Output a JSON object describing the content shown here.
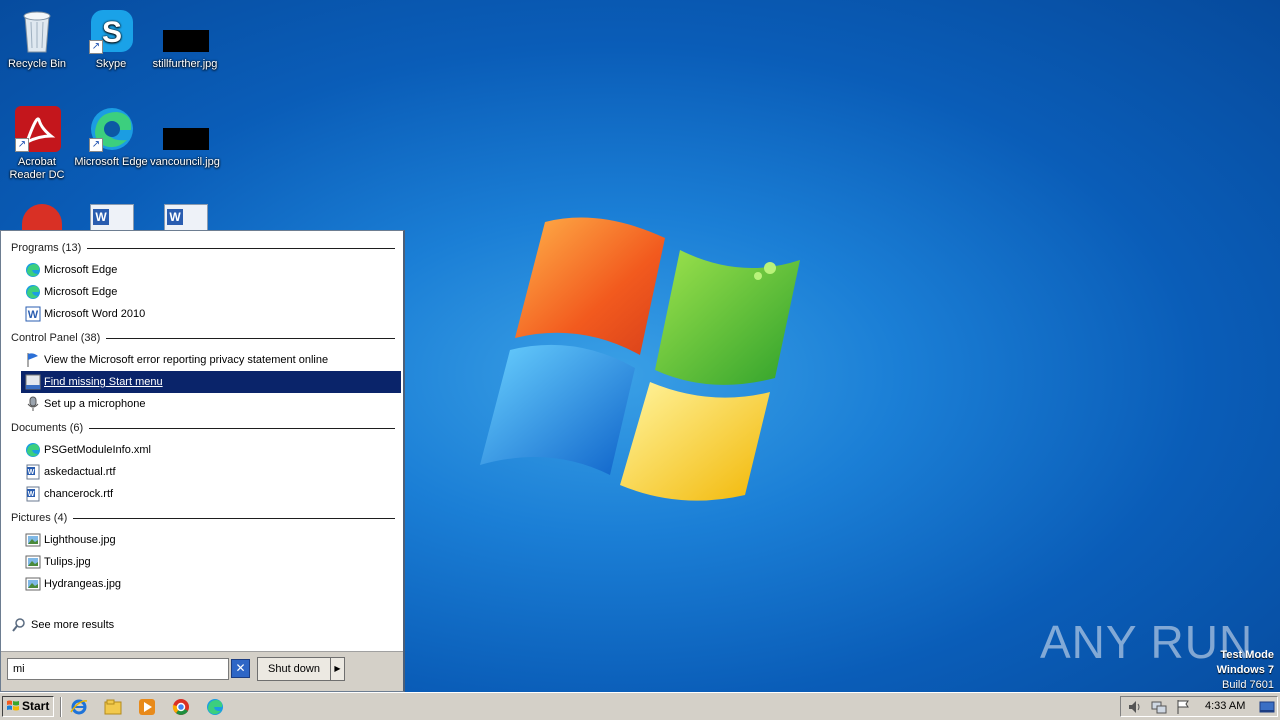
{
  "desktop": {
    "icons": [
      {
        "label": "Recycle Bin",
        "icon": "recycle-bin-icon"
      },
      {
        "label": "Skype",
        "icon": "skype-icon"
      },
      {
        "label": "stillfurther.jpg",
        "icon": "image-file-icon"
      },
      {
        "label": "Acrobat Reader DC",
        "icon": "acrobat-icon"
      },
      {
        "label": "Microsoft Edge",
        "icon": "edge-icon"
      },
      {
        "label": "vancouncil.jpg",
        "icon": "image-file-icon"
      }
    ]
  },
  "start_menu": {
    "sections": [
      {
        "title": "Programs (13)",
        "items": [
          {
            "label": "Microsoft Edge",
            "icon": "edge-icon"
          },
          {
            "label": "Microsoft Edge",
            "icon": "edge-icon"
          },
          {
            "label": "Microsoft Word 2010",
            "icon": "word-icon"
          }
        ]
      },
      {
        "title": "Control Panel (38)",
        "items": [
          {
            "label": "View the Microsoft error reporting privacy statement online",
            "icon": "flag-icon"
          },
          {
            "label": "Find missing Start menu",
            "icon": "taskbar-settings-icon",
            "selected": true
          },
          {
            "label": "Set up a microphone",
            "icon": "microphone-icon"
          }
        ]
      },
      {
        "title": "Documents (6)",
        "items": [
          {
            "label": "PSGetModuleInfo.xml",
            "icon": "edge-icon"
          },
          {
            "label": "askedactual.rtf",
            "icon": "word-doc-icon"
          },
          {
            "label": "chancerock.rtf",
            "icon": "word-doc-icon"
          }
        ]
      },
      {
        "title": "Pictures (4)",
        "items": [
          {
            "label": "Lighthouse.jpg",
            "icon": "picture-icon"
          },
          {
            "label": "Tulips.jpg",
            "icon": "picture-icon"
          },
          {
            "label": "Hydrangeas.jpg",
            "icon": "picture-icon"
          }
        ]
      }
    ],
    "see_more": "See more results",
    "search_value": "mi",
    "clear_symbol": "✕",
    "shutdown_label": "Shut down",
    "shutdown_arrow": "▶"
  },
  "taskbar": {
    "start_label": "Start",
    "apps": [
      "internet-explorer-icon",
      "file-explorer-icon",
      "media-player-icon",
      "chrome-icon",
      "edge-icon"
    ],
    "clock": "4:33 AM"
  },
  "watermark": "ANY RUN",
  "test_mode": {
    "line1": "Test Mode",
    "line2": "Windows 7",
    "line3": "Build 7601"
  },
  "colors": {
    "desktop_blue": "#1b7fd6",
    "selection": "#0a246a",
    "taskbar": "#d4d0c8"
  }
}
